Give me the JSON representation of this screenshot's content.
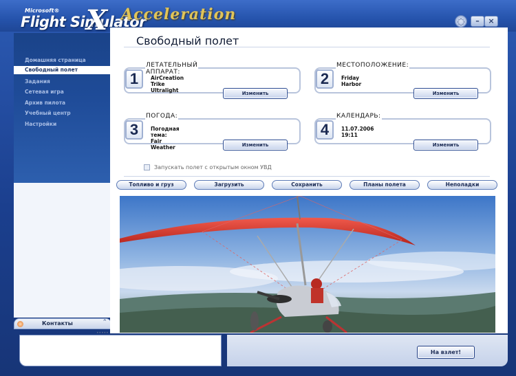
{
  "app": {
    "brand_small": "Microsoft®",
    "brand_main": "Flight Simulator",
    "brand_x": "X",
    "brand_edition": "Acceleration"
  },
  "sidebar": {
    "items": [
      {
        "label": "Домашняя страница"
      },
      {
        "label": "Свободный полет",
        "active": true
      },
      {
        "label": "Задания"
      },
      {
        "label": "Сетевая игра"
      },
      {
        "label": "Архив пилота"
      },
      {
        "label": "Учебный центр"
      },
      {
        "label": "Настройки"
      }
    ],
    "contacts_label": "Контакты"
  },
  "page": {
    "title": "Свободный полет"
  },
  "cards": [
    {
      "number": "1",
      "label": "ЛЕТАТЕЛЬНЫЙ АППАРАТ:",
      "value": "AirCreation Trike Ultralight",
      "button": "Изменить"
    },
    {
      "number": "2",
      "label": "МЕСТОПОЛОЖЕНИЕ:",
      "value": "Friday Harbor",
      "button": "Изменить"
    },
    {
      "number": "3",
      "label": "ПОГОДА:",
      "value": "Погодная тема: Fair Weather",
      "button": "Изменить"
    },
    {
      "number": "4",
      "label": "КАЛЕНДАРЬ:",
      "value": "11.07.2006 19:11",
      "button": "Изменить"
    }
  ],
  "vfr_option": {
    "label": "Запускать полет с открытым окном УВД",
    "checked": false
  },
  "toolbar": {
    "fuel": "Топливо и груз",
    "load": "Загрузить",
    "save": "Сохранить",
    "plans": "Планы полета",
    "failures": "Неполадки"
  },
  "fly_button": "На взлет!",
  "colors": {
    "frame_blue": "#2553ac",
    "wing_red": "#d8392f",
    "panel_white": "#ffffff"
  }
}
